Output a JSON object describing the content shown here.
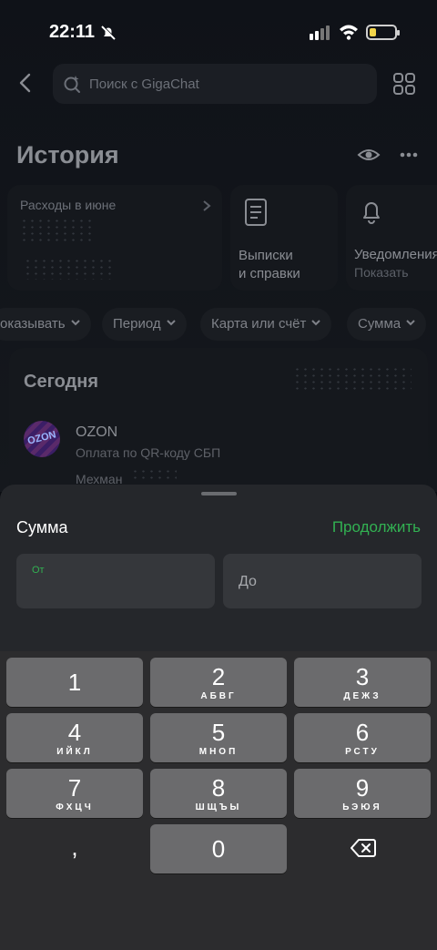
{
  "status_bar": {
    "time": "22:11"
  },
  "search": {
    "placeholder": "Поиск с GigaChat"
  },
  "history": {
    "title": "История"
  },
  "cards": {
    "expenses": "Расходы в июне",
    "statements_line1": "Выписки",
    "statements_line2": "и справки",
    "notifications": "Уведомления",
    "notifications_sub": "Показать"
  },
  "filters": [
    {
      "label": "оказывать"
    },
    {
      "label": "Период"
    },
    {
      "label": "Карта или счёт"
    },
    {
      "label": "Сумма"
    }
  ],
  "today": {
    "title": "Сегодня",
    "transaction": {
      "logo_text": "OZON",
      "merchant": "OZON",
      "description": "Оплата по QR-коду СБП",
      "payer": "Мехман"
    }
  },
  "sheet": {
    "title": "Сумма",
    "continue_label": "Продолжить",
    "from_label": "От",
    "to_label": "До"
  },
  "keypad": {
    "keys": [
      {
        "digit": "1",
        "letters": ""
      },
      {
        "digit": "2",
        "letters": "АБВГ"
      },
      {
        "digit": "3",
        "letters": "ДЕЖЗ"
      },
      {
        "digit": "4",
        "letters": "ИЙКЛ"
      },
      {
        "digit": "5",
        "letters": "МНОП"
      },
      {
        "digit": "6",
        "letters": "РСТУ"
      },
      {
        "digit": "7",
        "letters": "ФХЦЧ"
      },
      {
        "digit": "8",
        "letters": "ШЩЪЫ"
      },
      {
        "digit": "9",
        "letters": "ЬЭЮЯ"
      },
      {
        "digit": ",",
        "letters": ""
      },
      {
        "digit": "0",
        "letters": ""
      }
    ]
  },
  "colors": {
    "accent_green": "#32b152",
    "battery_yellow": "#f3d54a"
  }
}
